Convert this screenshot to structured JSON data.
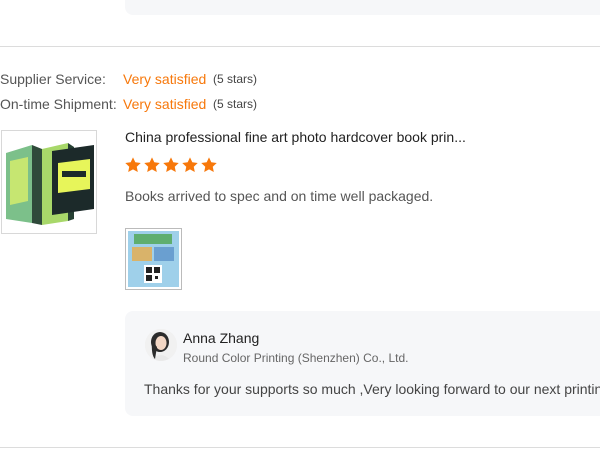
{
  "ratings": [
    {
      "label": "Supplier Service:",
      "value": "Very satisfied",
      "stars": "(5 stars)"
    },
    {
      "label": "On-time Shipment:",
      "value": "Very satisfied",
      "stars": "(5 stars)"
    }
  ],
  "review": {
    "product_title": "China professional fine art photo hardcover book prin...",
    "star_count": 5,
    "star_color": "#f7780b",
    "text": "Books arrived to spec and on time well packaged."
  },
  "reply": {
    "name": "Anna Zhang",
    "company": "Round Color Printing (Shenzhen) Co., Ltd.",
    "text": "Thanks for your supports so much ,Very looking forward to our next printing"
  },
  "colors": {
    "accent": "#f7780b",
    "card_bg": "#f6f7f9",
    "divider": "#dcdcdc"
  }
}
